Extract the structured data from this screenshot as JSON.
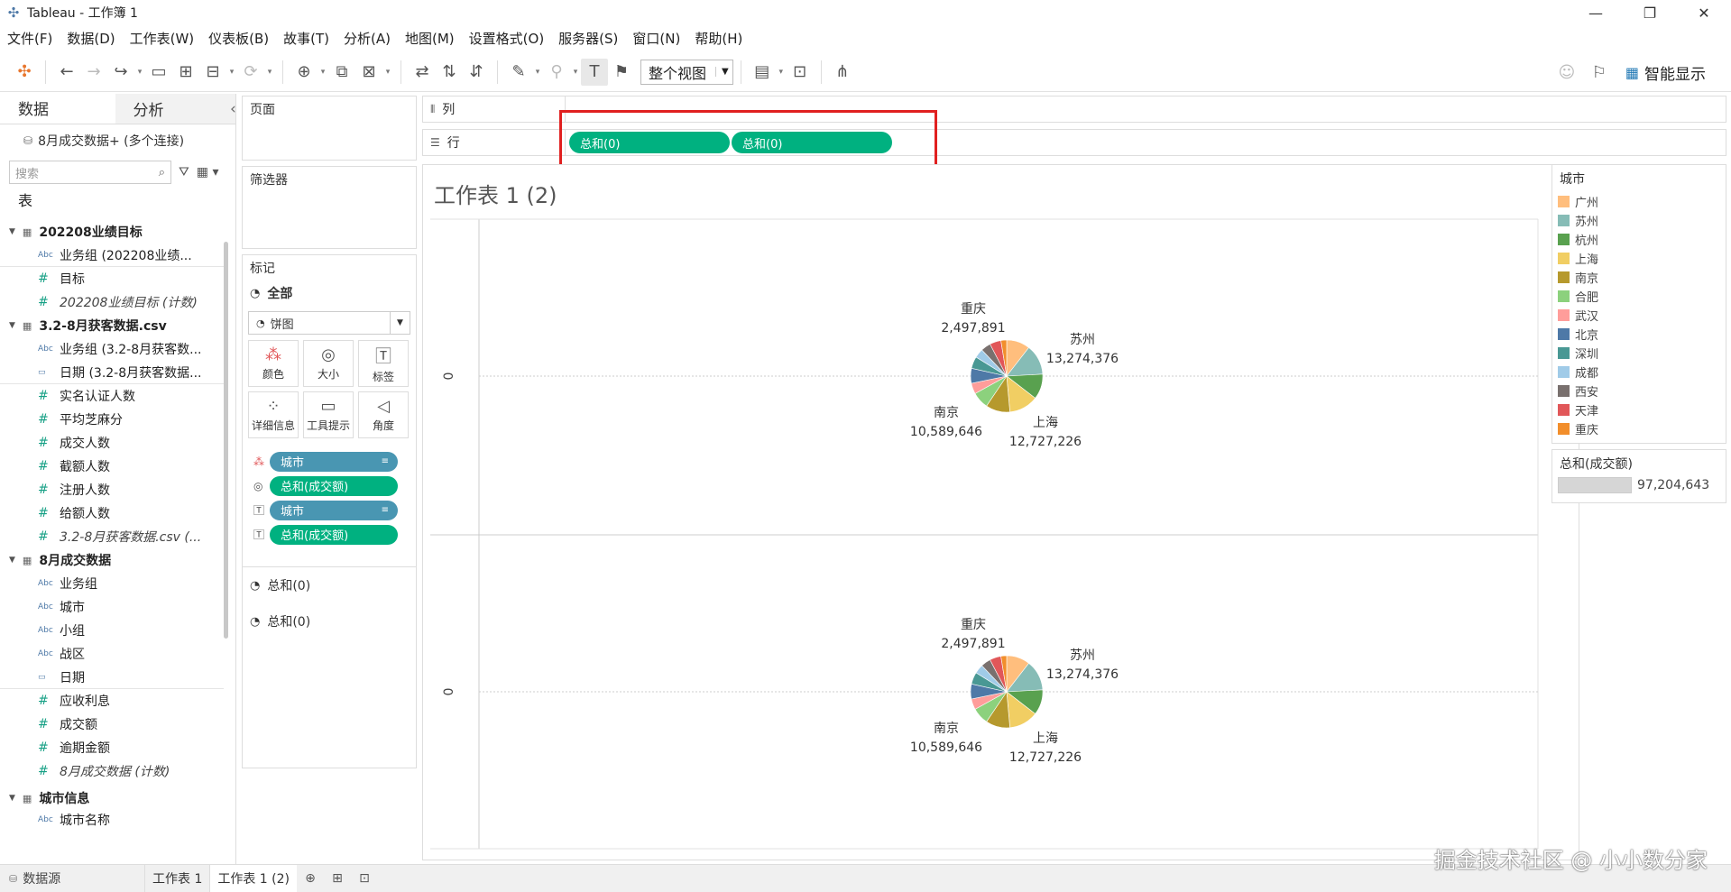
{
  "window": {
    "title": "Tableau - 工作簿 1",
    "minimize": "—",
    "restore": "❐",
    "close": "✕"
  },
  "menu": [
    "文件(F)",
    "数据(D)",
    "工作表(W)",
    "仪表板(B)",
    "故事(T)",
    "分析(A)",
    "地图(M)",
    "设置格式(O)",
    "服务器(S)",
    "窗口(N)",
    "帮助(H)"
  ],
  "toolbar": {
    "fit_label": "整个视图",
    "show_me_label": "智能显示"
  },
  "datapane": {
    "tab_data": "数据",
    "tab_analysis": "分析",
    "connection": "8月成交数据+ (多个连接)",
    "search_placeholder": "搜索",
    "tables_label": "表",
    "groups": [
      {
        "name": "202208业绩目标",
        "fields": [
          {
            "type": "Abc",
            "name": "业务组 (202208业绩..."
          },
          {
            "type": "#",
            "name": "目标"
          },
          {
            "type": "#",
            "name": "202208业绩目标 (计数)",
            "italic": true
          }
        ]
      },
      {
        "name": "3.2-8月获客数据.csv",
        "fields": [
          {
            "type": "Abc",
            "name": "业务组 (3.2-8月获客数..."
          },
          {
            "type": "date",
            "name": "日期 (3.2-8月获客数据..."
          },
          {
            "type": "#",
            "name": "实名认证人数"
          },
          {
            "type": "#",
            "name": "平均芝麻分"
          },
          {
            "type": "#",
            "name": "成交人数"
          },
          {
            "type": "#",
            "name": "截额人数"
          },
          {
            "type": "#",
            "name": "注册人数"
          },
          {
            "type": "#",
            "name": "给额人数"
          },
          {
            "type": "#",
            "name": "3.2-8月获客数据.csv (...",
            "italic": true
          }
        ]
      },
      {
        "name": "8月成交数据",
        "fields": [
          {
            "type": "Abc",
            "name": "业务组"
          },
          {
            "type": "Abc",
            "name": "城市"
          },
          {
            "type": "Abc",
            "name": "小组"
          },
          {
            "type": "Abc",
            "name": "战区"
          },
          {
            "type": "date",
            "name": "日期"
          },
          {
            "type": "#",
            "name": "应收利息"
          },
          {
            "type": "#",
            "name": "成交额"
          },
          {
            "type": "#",
            "name": "逾期金额"
          },
          {
            "type": "#",
            "name": "8月成交数据 (计数)",
            "italic": true
          }
        ]
      },
      {
        "name": "城市信息",
        "fields": [
          {
            "type": "Abc",
            "name": "城市名称"
          }
        ]
      }
    ]
  },
  "shelves": {
    "pages": "页面",
    "filters": "筛选器",
    "marks": "标记",
    "marks_all": "全部",
    "mark_type": "饼图",
    "mark_buttons": [
      "颜色",
      "大小",
      "标签",
      "详细信息",
      "工具提示",
      "角度"
    ],
    "mark_pills": [
      {
        "icon": "color",
        "label": "城市",
        "kind": "dim"
      },
      {
        "icon": "size",
        "label": "总和(成交额)",
        "kind": "meas"
      },
      {
        "icon": "label",
        "label": "城市",
        "kind": "dim"
      },
      {
        "icon": "label",
        "label": "总和(成交额)",
        "kind": "meas"
      }
    ],
    "sub_marks": [
      "总和(0)",
      "总和(0)"
    ],
    "columns_label": "列",
    "rows_label": "行",
    "row_pills": [
      "总和(0)",
      "总和(0)"
    ]
  },
  "viz": {
    "title": "工作表 1 (2)",
    "axis_tick": "0",
    "labels": [
      {
        "city": "重庆",
        "value": "2,497,891"
      },
      {
        "city": "苏州",
        "value": "13,274,376"
      },
      {
        "city": "南京",
        "value": "10,589,646"
      },
      {
        "city": "上海",
        "value": "12,727,226"
      }
    ]
  },
  "legend": {
    "title": "城市",
    "items": [
      {
        "name": "广州",
        "color": "#ffbe7d"
      },
      {
        "name": "苏州",
        "color": "#86bcb6"
      },
      {
        "name": "杭州",
        "color": "#59a14f"
      },
      {
        "name": "上海",
        "color": "#f1ce63"
      },
      {
        "name": "南京",
        "color": "#b6992d"
      },
      {
        "name": "合肥",
        "color": "#8cd17d"
      },
      {
        "name": "武汉",
        "color": "#ff9d9a"
      },
      {
        "name": "北京",
        "color": "#4e79a7"
      },
      {
        "name": "深圳",
        "color": "#499894"
      },
      {
        "name": "成都",
        "color": "#a0cbe8"
      },
      {
        "name": "西安",
        "color": "#79706e"
      },
      {
        "name": "天津",
        "color": "#e15759"
      },
      {
        "name": "重庆",
        "color": "#f28e2b"
      }
    ]
  },
  "size_legend": {
    "title": "总和(成交额)",
    "value": "97,204,643"
  },
  "bottom": {
    "datasource": "数据源",
    "sheets": [
      "工作表 1",
      "工作表 1 (2)"
    ],
    "active": 1
  },
  "watermark": "掘金技术社区 @ 小小数分家",
  "chart_data": {
    "type": "pie",
    "title": "工作表 1 (2)",
    "panes": 2,
    "total": 97204643,
    "slices": [
      {
        "name": "广州",
        "value": 10200000
      },
      {
        "name": "苏州",
        "value": 13274376
      },
      {
        "name": "杭州",
        "value": 11000000
      },
      {
        "name": "上海",
        "value": 12727226
      },
      {
        "name": "南京",
        "value": 10589646
      },
      {
        "name": "合肥",
        "value": 7300000
      },
      {
        "name": "武汉",
        "value": 4700000
      },
      {
        "name": "北京",
        "value": 6500000
      },
      {
        "name": "深圳",
        "value": 5200000
      },
      {
        "name": "成都",
        "value": 4000000
      },
      {
        "name": "西安",
        "value": 4300000
      },
      {
        "name": "天津",
        "value": 4915504
      },
      {
        "name": "重庆",
        "value": 2497891
      }
    ]
  }
}
